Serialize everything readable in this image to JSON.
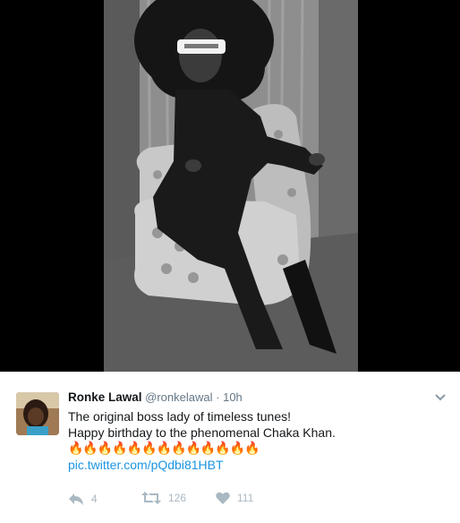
{
  "media": {
    "alt": "",
    "watermark": ""
  },
  "tweet": {
    "author_name": "Ronke Lawal",
    "author_handle": "@ronkelawal",
    "separator": "·",
    "time": "10h",
    "line1": "The original boss lady of timeless tunes!",
    "line2": "Happy birthday to the phenomenal Chaka Khan.",
    "emoji_line": "🔥🔥🔥🔥🔥🔥🔥🔥🔥🔥🔥🔥🔥",
    "link": "pic.twitter.com/pQdbi81HBT",
    "reply_count": "4",
    "retweet_count": "126",
    "like_count": "111"
  },
  "icons": {
    "caret": "chevron-down-icon",
    "reply": "reply-icon",
    "retweet": "retweet-icon",
    "like": "heart-icon"
  },
  "colors": {
    "link": "#1b95e0",
    "name": "#14171a",
    "meta": "#657786",
    "action": "#aab8c2",
    "media_bg": "#000000"
  }
}
